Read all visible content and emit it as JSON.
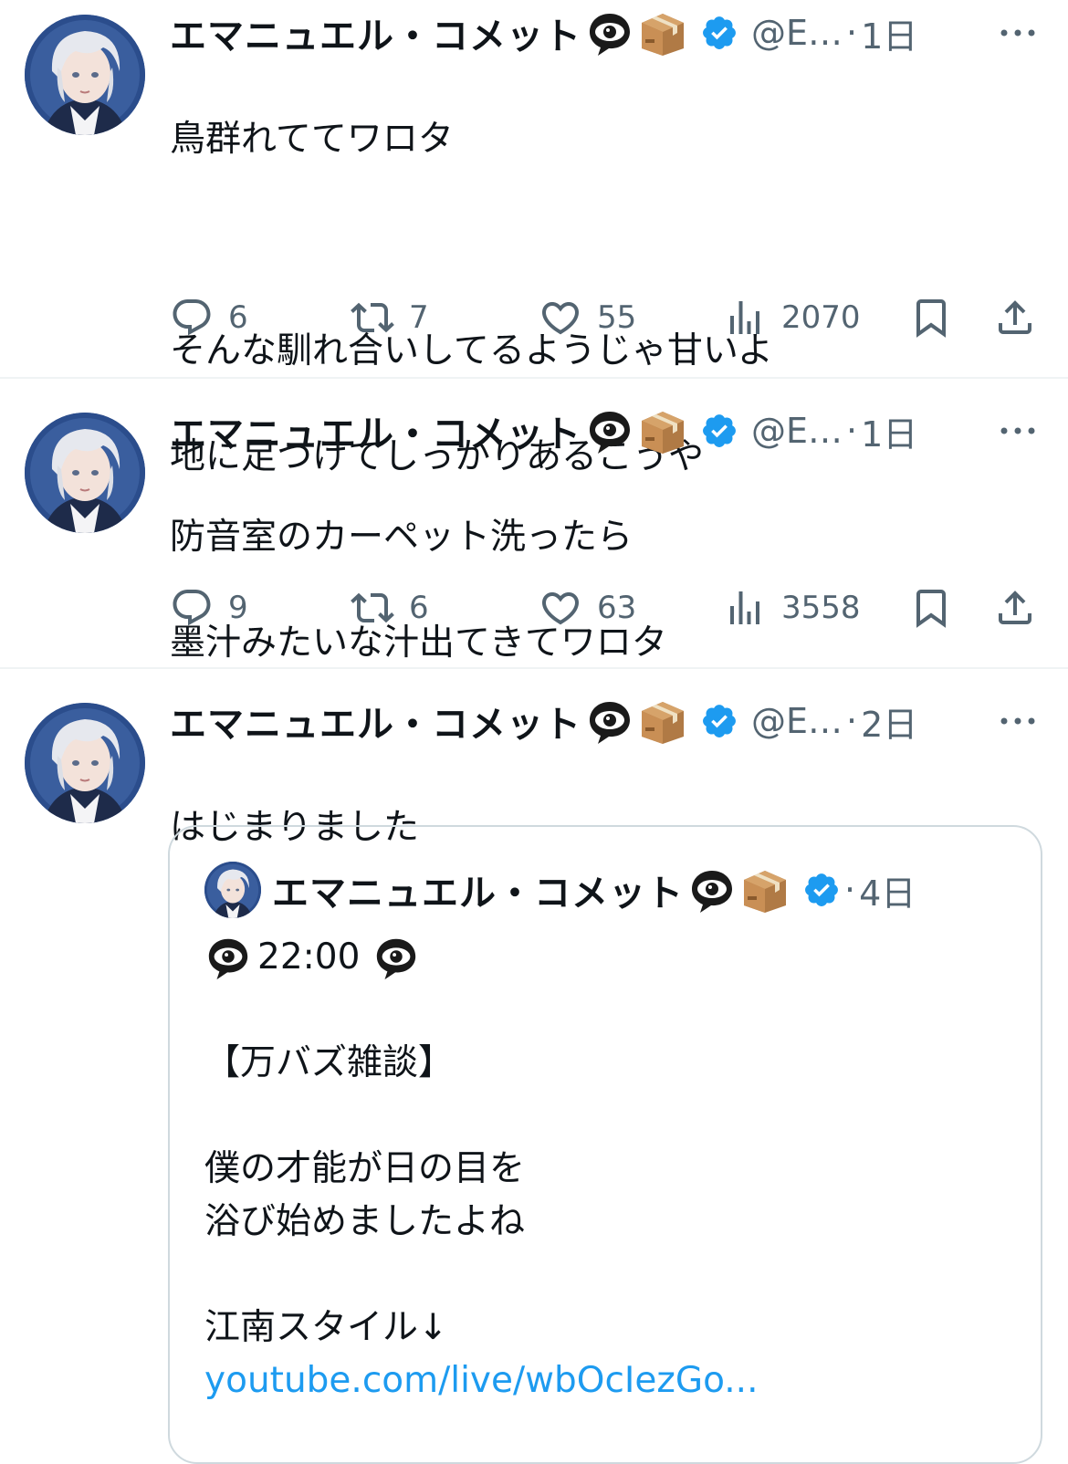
{
  "colors": {
    "accent": "#1d9bf0",
    "muted": "#536471",
    "text": "#0f1419",
    "divider": "#eff3f4"
  },
  "icons": [
    "eye-in-speech-bubble-emoji",
    "package-emoji",
    "verified-badge-icon",
    "more-icon",
    "reply-icon",
    "retweet-icon",
    "like-icon",
    "views-icon",
    "bookmark-icon",
    "share-icon"
  ],
  "tweets": [
    {
      "name": "エマニュエル・コメット",
      "handle": "@E…",
      "dot": "·",
      "time": "1日",
      "lines": [
        "鳥群れててワロタ",
        "",
        "そんな馴れ合いしてるようじゃ甘いよ",
        "地に足つけてしっかりあるこうや"
      ],
      "replies": "6",
      "retweets": "7",
      "likes": "55",
      "views": "2070"
    },
    {
      "name": "エマニュエル・コメット",
      "handle": "@E…",
      "dot": "·",
      "time": "1日",
      "lines": [
        "防音室のカーペット洗ったら",
        "墨汁みたいな汁出てきてワロタ"
      ],
      "replies": "9",
      "retweets": "6",
      "likes": "63",
      "views": "3558"
    },
    {
      "name": "エマニュエル・コメット",
      "handle": "@E…",
      "dot": "·",
      "time": "2日",
      "lines": [
        "はじまりました"
      ],
      "quote": {
        "name": "エマニュエル・コメット",
        "dot": "·",
        "time": "4日",
        "time_line": "22:00",
        "lines": [
          "",
          " 【万バズ雑談】",
          "",
          "僕の才能が日の目を",
          "浴び始めましたよね",
          "",
          "江南スタイル↓"
        ],
        "link": "youtube.com/live/wbOcIezGo..."
      }
    }
  ]
}
